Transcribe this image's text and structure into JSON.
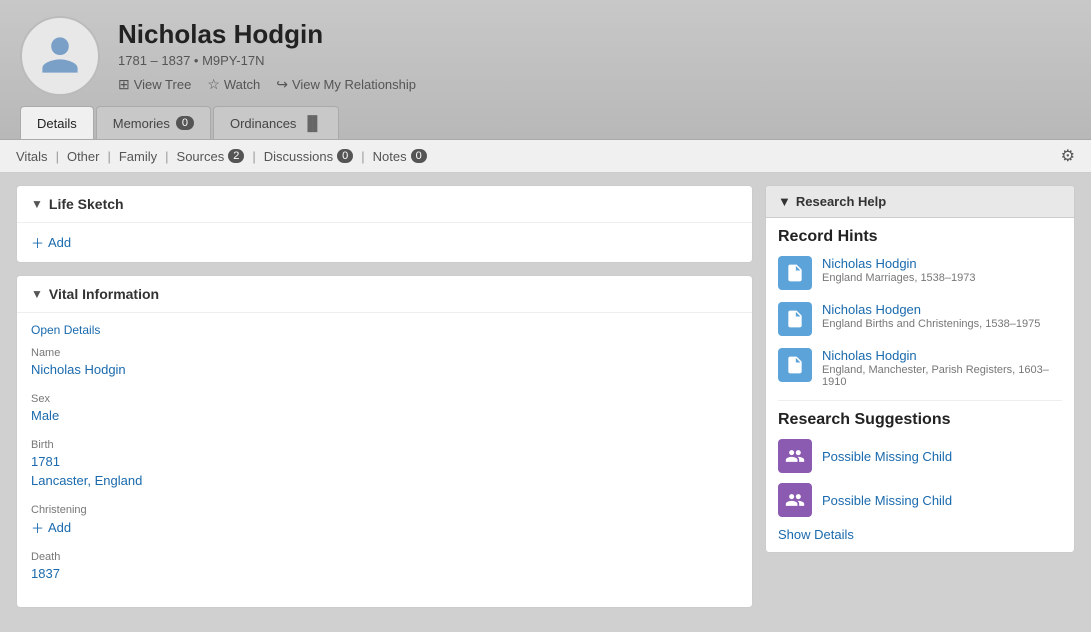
{
  "person": {
    "name": "Nicholas Hodgin",
    "dates": "1781 – 1837 • M9PY-17N",
    "actions": {
      "view_tree": "View Tree",
      "watch": "Watch",
      "view_relationship": "View My Relationship"
    }
  },
  "main_tabs": [
    {
      "id": "details",
      "label": "Details",
      "active": true
    },
    {
      "id": "memories",
      "label": "Memories",
      "badge": "0"
    },
    {
      "id": "ordinances",
      "label": "Ordinances",
      "chart": true
    }
  ],
  "sub_nav": {
    "items": [
      {
        "id": "vitals",
        "label": "Vitals"
      },
      {
        "id": "other",
        "label": "Other"
      },
      {
        "id": "family",
        "label": "Family"
      },
      {
        "id": "sources",
        "label": "Sources",
        "badge": "2"
      },
      {
        "id": "discussions",
        "label": "Discussions",
        "badge": "0"
      },
      {
        "id": "notes",
        "label": "Notes",
        "badge": "0"
      }
    ]
  },
  "life_sketch": {
    "title": "Life Sketch",
    "add_label": "Add"
  },
  "vital_info": {
    "title": "Vital Information",
    "open_details": "Open Details",
    "fields": [
      {
        "label": "Name",
        "value": "Nicholas Hodgin",
        "link": true
      },
      {
        "label": "Sex",
        "value": "Male",
        "link": true
      },
      {
        "label": "Birth",
        "value": "1781\nLancaster, England",
        "link": true
      },
      {
        "label": "Christening",
        "value": null,
        "add": true
      },
      {
        "label": "Death",
        "value": "1837",
        "link": true
      }
    ],
    "add_label": "Add"
  },
  "research_help": {
    "title": "Research Help",
    "record_hints_title": "Record Hints",
    "hints": [
      {
        "name": "Nicholas Hodgin",
        "description": "England Marriages, 1538–1973"
      },
      {
        "name": "Nicholas Hodgen",
        "description": "England Births and Christenings, 1538–1975"
      },
      {
        "name": "Nicholas Hodgin",
        "description": "England, Manchester, Parish Registers, 1603–1910"
      }
    ],
    "suggestions_title": "Research Suggestions",
    "suggestions": [
      {
        "label": "Possible Missing Child"
      },
      {
        "label": "Possible Missing Child"
      }
    ],
    "show_details": "Show Details"
  }
}
